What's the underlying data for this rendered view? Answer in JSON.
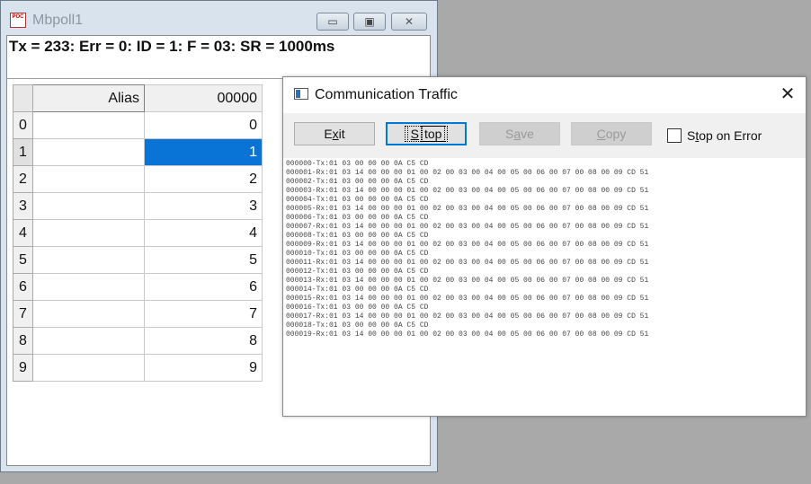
{
  "mbpoll": {
    "title": "Mbpoll1",
    "icon_text": "POC",
    "controls": {
      "minimize": "▭",
      "maximize": "▣",
      "close": "✕"
    },
    "status": "Tx = 233: Err = 0: ID = 1: F = 03: SR = 1000ms",
    "grid": {
      "alias_header": "Alias",
      "value_header": "00000",
      "rows": [
        {
          "index": "0",
          "alias": "",
          "value": "0"
        },
        {
          "index": "1",
          "alias": "",
          "value": "1"
        },
        {
          "index": "2",
          "alias": "",
          "value": "2"
        },
        {
          "index": "3",
          "alias": "",
          "value": "3"
        },
        {
          "index": "4",
          "alias": "",
          "value": "4"
        },
        {
          "index": "5",
          "alias": "",
          "value": "5"
        },
        {
          "index": "6",
          "alias": "",
          "value": "6"
        },
        {
          "index": "7",
          "alias": "",
          "value": "7"
        },
        {
          "index": "8",
          "alias": "",
          "value": "8"
        },
        {
          "index": "9",
          "alias": "",
          "value": "9"
        }
      ],
      "selected_row": 1,
      "selection_color": "#0a74d6"
    }
  },
  "traffic": {
    "title": "Communication Traffic",
    "close": "✕",
    "buttons": {
      "exit": {
        "pre": "E",
        "u": "x",
        "post": "it"
      },
      "stop": {
        "pre": "",
        "u": "S",
        "post": "top"
      },
      "save": {
        "pre": "S",
        "u": "a",
        "post": "ve"
      },
      "copy": {
        "pre": "",
        "u": "C",
        "post": "opy"
      }
    },
    "stop_on_error": {
      "pre": "S",
      "u": "t",
      "post": "op on Error",
      "checked": false
    },
    "log": [
      "000000-Tx:01 03 00 00 00 0A C5 CD",
      "000001-Rx:01 03 14 00 00 00 01 00 02 00 03 00 04 00 05 00 06 00 07 00 08 00 09 CD 51",
      "000002-Tx:01 03 00 00 00 0A C5 CD",
      "000003-Rx:01 03 14 00 00 00 01 00 02 00 03 00 04 00 05 00 06 00 07 00 08 00 09 CD 51",
      "000004-Tx:01 03 00 00 00 0A C5 CD",
      "000005-Rx:01 03 14 00 00 00 01 00 02 00 03 00 04 00 05 00 06 00 07 00 08 00 09 CD 51",
      "000006-Tx:01 03 00 00 00 0A C5 CD",
      "000007-Rx:01 03 14 00 00 00 01 00 02 00 03 00 04 00 05 00 06 00 07 00 08 00 09 CD 51",
      "000008-Tx:01 03 00 00 00 0A C5 CD",
      "000009-Rx:01 03 14 00 00 00 01 00 02 00 03 00 04 00 05 00 06 00 07 00 08 00 09 CD 51",
      "000010-Tx:01 03 00 00 00 0A C5 CD",
      "000011-Rx:01 03 14 00 00 00 01 00 02 00 03 00 04 00 05 00 06 00 07 00 08 00 09 CD 51",
      "000012-Tx:01 03 00 00 00 0A C5 CD",
      "000013-Rx:01 03 14 00 00 00 01 00 02 00 03 00 04 00 05 00 06 00 07 00 08 00 09 CD 51",
      "000014-Tx:01 03 00 00 00 0A C5 CD",
      "000015-Rx:01 03 14 00 00 00 01 00 02 00 03 00 04 00 05 00 06 00 07 00 08 00 09 CD 51",
      "000016-Tx:01 03 00 00 00 0A C5 CD",
      "000017-Rx:01 03 14 00 00 00 01 00 02 00 03 00 04 00 05 00 06 00 07 00 08 00 09 CD 51",
      "000018-Tx:01 03 00 00 00 0A C5 CD",
      "000019-Rx:01 03 14 00 00 00 01 00 02 00 03 00 04 00 05 00 06 00 07 00 08 00 09 CD 51"
    ]
  }
}
